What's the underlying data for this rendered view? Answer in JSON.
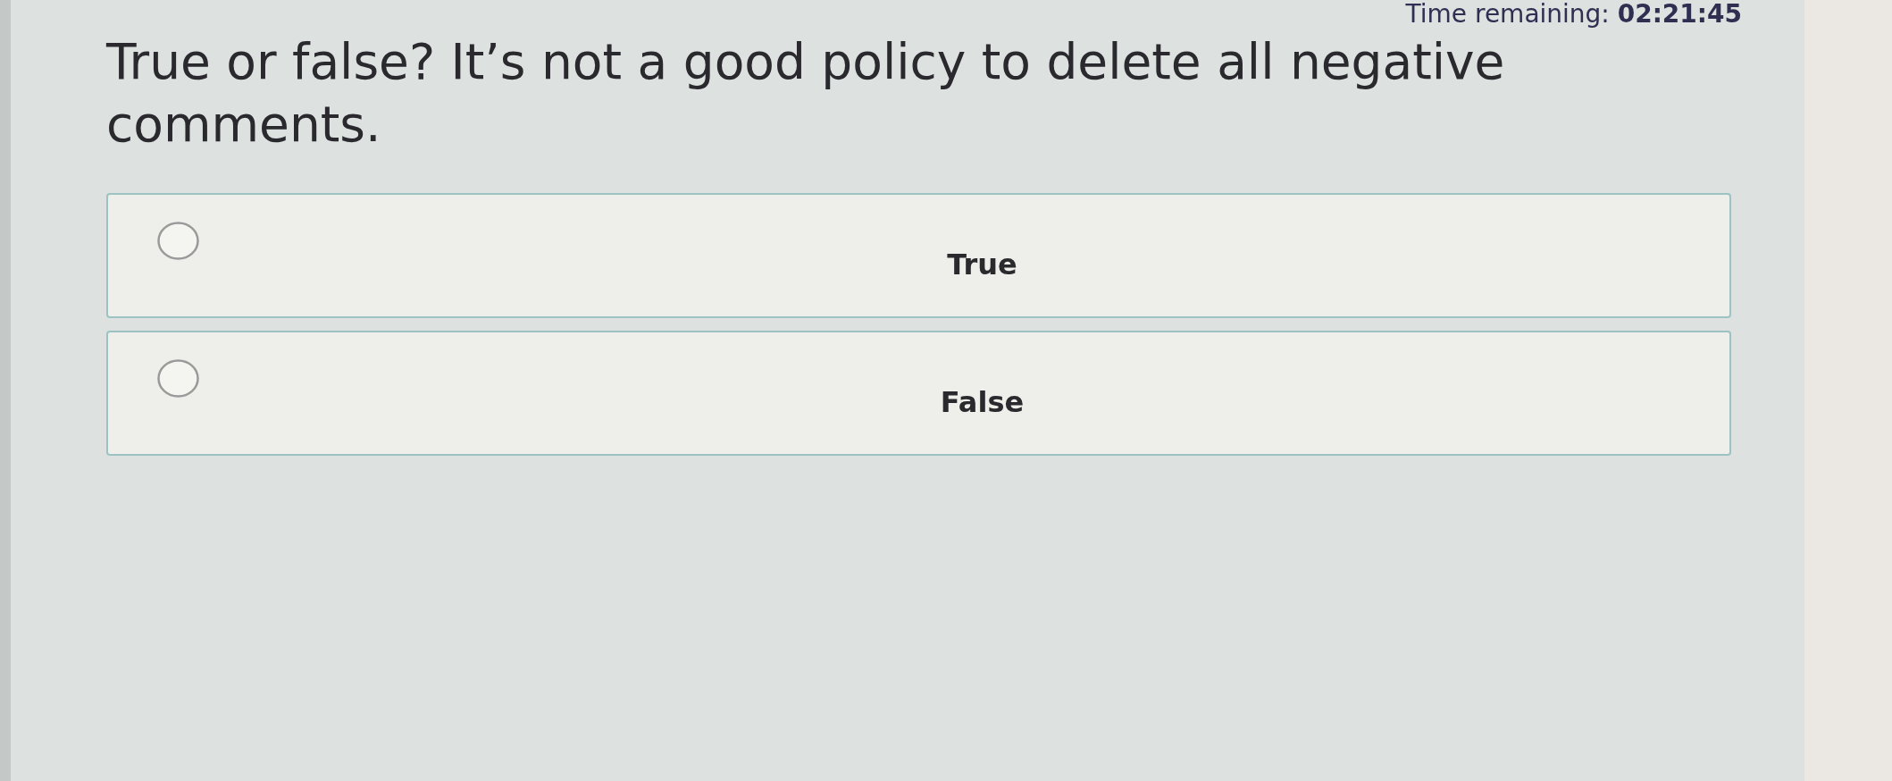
{
  "timer": {
    "text": "Time remaining: **02:21:45**"
  },
  "question": {
    "text": "True or false? It’s not a good policy to delete all negative comments."
  },
  "options": [
    {
      "label": "True",
      "selected": false
    },
    {
      "label": "False",
      "selected": false
    }
  ]
}
